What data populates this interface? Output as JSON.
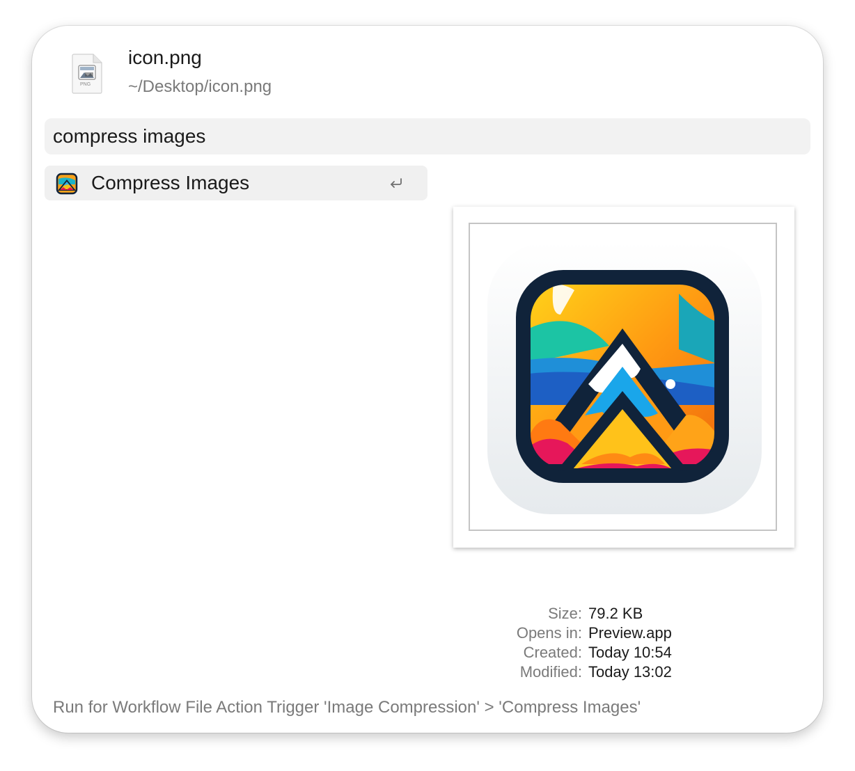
{
  "file": {
    "name": "icon.png",
    "path": "~/Desktop/icon.png",
    "type_badge": "PNG",
    "icon": "png-file-icon"
  },
  "search": {
    "value": "compress images"
  },
  "results": [
    {
      "label": "Compress Images",
      "icon": "mountain-app-icon",
      "action_icon": "return-key-icon"
    }
  ],
  "metadata": {
    "labels": [
      "Size:",
      "Opens in:",
      "Created:",
      "Modified:"
    ],
    "values": [
      "79.2 KB",
      "Preview.app",
      "Today 10:54",
      "Today 13:02"
    ]
  },
  "footer": {
    "text": "Run for Workflow File Action Trigger 'Image Compression' > 'Compress Images'"
  },
  "colors": {
    "window_bg": "#ffffff",
    "search_bg": "#f2f2f2",
    "selected_row_bg": "#f0f0f0",
    "secondary_text": "#7a7a7a",
    "primary_text": "#1a1a1a"
  }
}
